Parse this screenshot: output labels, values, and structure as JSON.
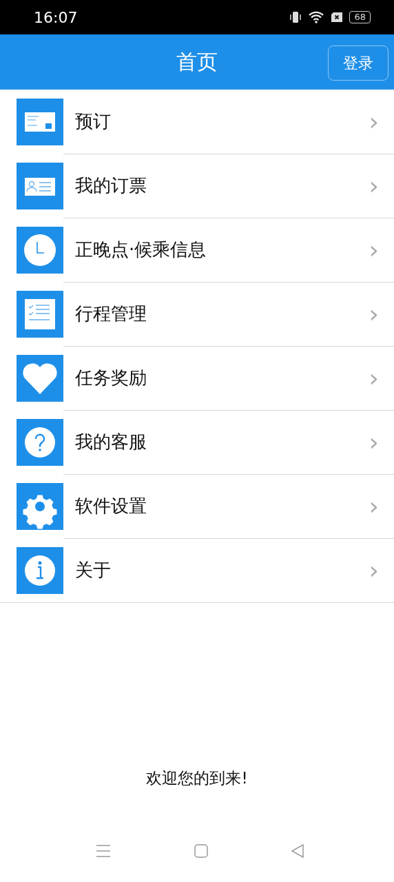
{
  "status_bar": {
    "time": "16:07",
    "battery": "68"
  },
  "header": {
    "title": "首页",
    "login_button": "登录"
  },
  "menu": [
    {
      "label": "预订",
      "chevron": "›"
    },
    {
      "label": "我的订票",
      "chevron": "›"
    },
    {
      "label": "正晚点·候乘信息",
      "chevron": "›"
    },
    {
      "label": "行程管理",
      "chevron": "›"
    },
    {
      "label": "任务奖励",
      "chevron": "›"
    },
    {
      "label": "我的客服",
      "chevron": "›"
    },
    {
      "label": "软件设置",
      "chevron": "›"
    },
    {
      "label": "关于",
      "chevron": "›"
    }
  ],
  "footer": {
    "welcome": "欢迎您的到来!"
  }
}
